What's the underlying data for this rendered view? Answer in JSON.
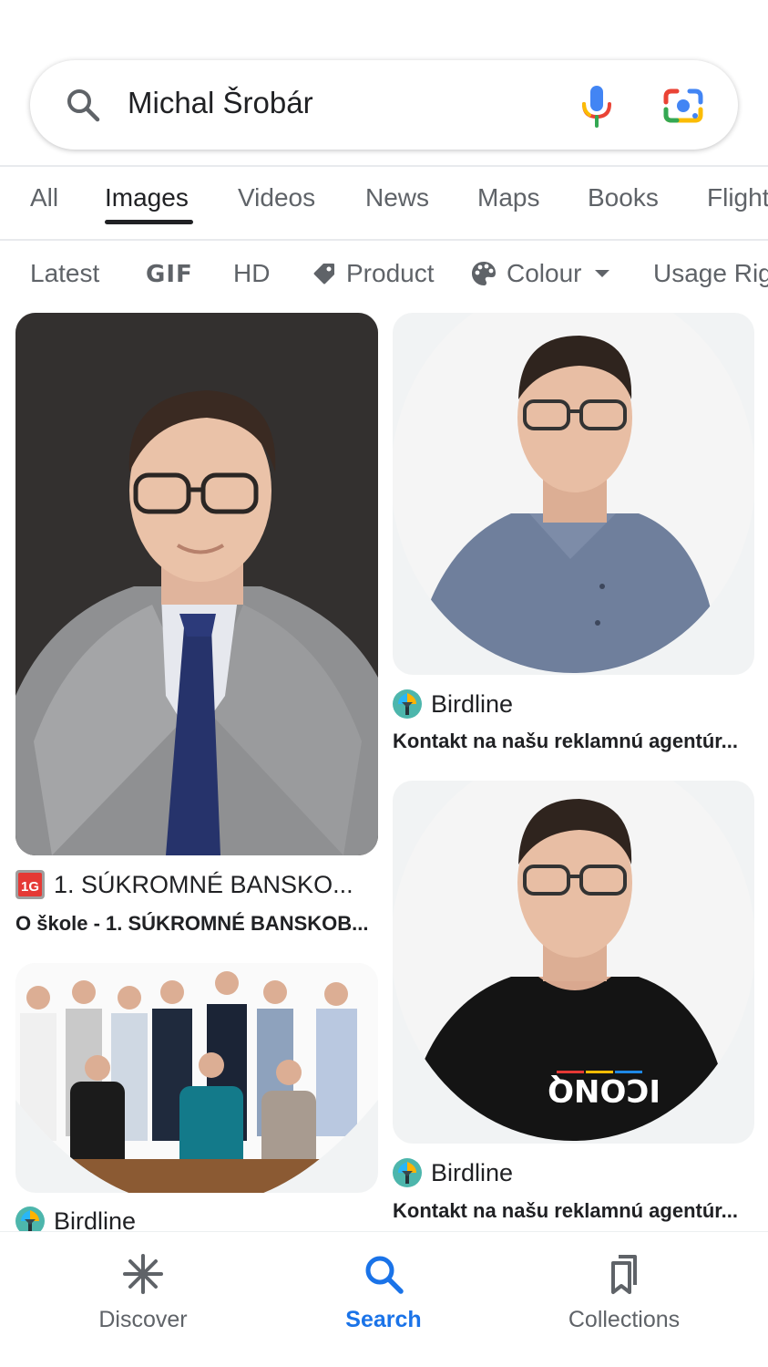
{
  "search": {
    "query": "Michal Šrobár",
    "icons": [
      "search-icon",
      "microphone-icon",
      "google-lens-icon"
    ]
  },
  "tabs": [
    {
      "label": "All",
      "active": false
    },
    {
      "label": "Images",
      "active": true
    },
    {
      "label": "Videos",
      "active": false
    },
    {
      "label": "News",
      "active": false
    },
    {
      "label": "Maps",
      "active": false
    },
    {
      "label": "Books",
      "active": false
    },
    {
      "label": "Flights",
      "active": false
    }
  ],
  "chips": [
    {
      "label": "Latest",
      "icon": ""
    },
    {
      "label": "GIF",
      "icon": ""
    },
    {
      "label": "HD",
      "icon": ""
    },
    {
      "label": "Product",
      "icon": "tag-icon"
    },
    {
      "label": "Colour",
      "icon": "palette-icon"
    },
    {
      "label": "Usage Rights",
      "icon": ""
    }
  ],
  "results": [
    {
      "source": "1. SÚKROMNÉ BANSKO...",
      "caption": "O škole - 1. SÚKROMNÉ BANSKOB...",
      "favicon": "school-logo-icon"
    },
    {
      "source": "Birdline",
      "caption": "Kontakt na našu reklamnú agentúr...",
      "favicon": "birdline-icon"
    },
    {
      "source": "Birdline",
      "caption": "Kontakt na našu reklamnú agentúr...",
      "favicon": "birdline-icon"
    },
    {
      "source": "Birdline",
      "caption": "",
      "favicon": "birdline-icon"
    }
  ],
  "shirt_text": "ICONQ",
  "nav": {
    "discover": "Discover",
    "search": "Search",
    "collections": "Collections",
    "active": "search"
  },
  "colors": {
    "accent": "#1a73e8",
    "text": "#202124",
    "muted": "#5f6368"
  }
}
